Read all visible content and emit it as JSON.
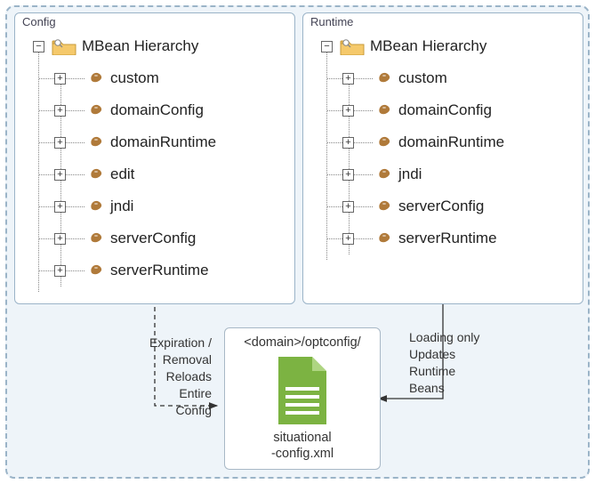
{
  "panels": {
    "config": {
      "title": "Config",
      "root": "MBean Hierarchy",
      "children": [
        "custom",
        "domainConfig",
        "domainRuntime",
        "edit",
        "jndi",
        "serverConfig",
        "serverRuntime"
      ]
    },
    "runtime": {
      "title": "Runtime",
      "root": "MBean Hierarchy",
      "children": [
        "custom",
        "domainConfig",
        "domainRuntime",
        "jndi",
        "serverConfig",
        "serverRuntime"
      ]
    }
  },
  "file": {
    "path_label": "<domain>/optconfig/",
    "name_line1": "situational",
    "name_line2": "-config.xml"
  },
  "captions": {
    "left_line1": "Expiration /",
    "left_line2": "Removal",
    "left_line3": "Reloads",
    "left_line4": "Entire",
    "left_line5": "Config",
    "right_line1": "Loading only",
    "right_line2": "Updates",
    "right_line3": "Runtime",
    "right_line4": "Beans"
  },
  "icons": {
    "expand": "+",
    "collapse": "−"
  }
}
